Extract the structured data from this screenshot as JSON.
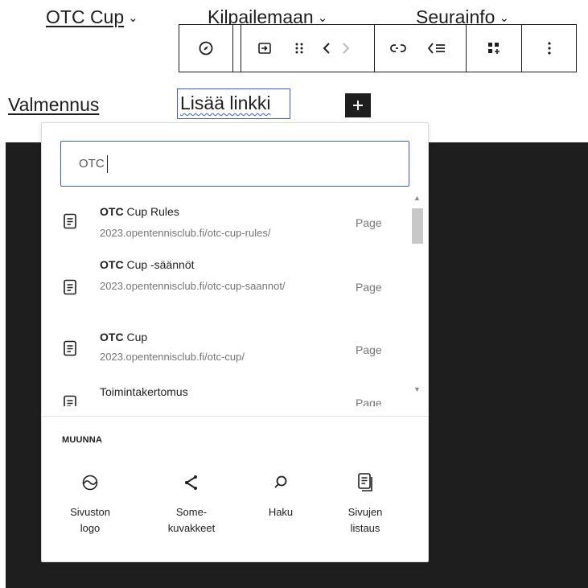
{
  "nav": {
    "items": [
      {
        "label": "OTC Cup",
        "chevron": "⌄"
      },
      {
        "label": "Kilpailemaan",
        "chevron": "⌄"
      },
      {
        "label": "Seurainfo",
        "chevron": "⌄"
      }
    ],
    "row2_link": "Valmennus"
  },
  "toolbar": {
    "buttons": [
      {
        "name": "navigation-icon"
      },
      {
        "name": "submenu-icon"
      },
      {
        "name": "drag-handle-icon"
      },
      {
        "name": "move-arrows-icon"
      },
      {
        "name": "unlink-icon"
      },
      {
        "name": "add-submenu-icon"
      },
      {
        "name": "convert-icon"
      },
      {
        "name": "more-options-icon"
      }
    ]
  },
  "link_editor": {
    "text": "Lisää linkki",
    "add_label": "+"
  },
  "search": {
    "query": "OTC"
  },
  "results": [
    {
      "bold": "OTC",
      "rest": " Cup Rules",
      "url": "2023.opentennisclub.fi/otc-cup-rules/",
      "type": "Page"
    },
    {
      "bold": "OTC",
      "rest": " Cup -säännöt",
      "url": "2023.opentennisclub.fi/otc-cup-saannot/",
      "type": "Page"
    },
    {
      "bold": "OTC",
      "rest": " Cup",
      "url": "2023.opentennisclub.fi/otc-cup/",
      "type": "Page"
    },
    {
      "bold": "",
      "rest": "Toimintakertomus",
      "url": "",
      "type": "Page"
    }
  ],
  "transform": {
    "heading": "MUUNNA",
    "items": [
      {
        "label": "Sivuston\nlogo",
        "icon": "site-logo-icon"
      },
      {
        "label": "Some-\nkuvakkeet",
        "icon": "share-icon"
      },
      {
        "label": "Haku",
        "icon": "search-icon"
      },
      {
        "label": "Sivujen\nlistaus",
        "icon": "page-list-icon"
      }
    ]
  },
  "colors": {
    "accent": "#3858e9",
    "dark_background": "#1e1e1e"
  }
}
